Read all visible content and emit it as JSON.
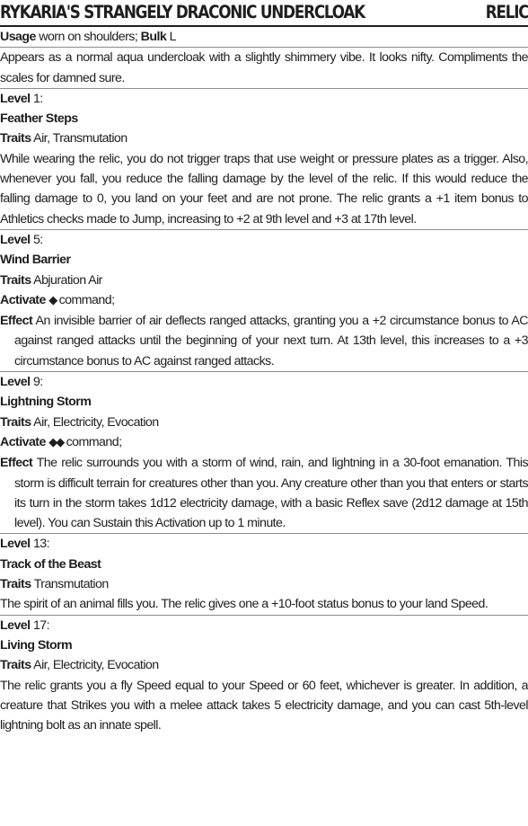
{
  "item": {
    "title": "RYKARIA'S STRANGELY DRACONIC UNDERCLOAK",
    "kind": "RELIC",
    "usage_label": "Usage",
    "usage_value": "worn on shoulders;",
    "bulk_label": "Bulk",
    "bulk_value": "L",
    "description": "Appears as a normal aqua undercloak with a slightly shimmery vibe. It looks nifty. Compliments the scales for damned sure."
  },
  "labels": {
    "level": "Level",
    "traits": "Traits",
    "activate": "Activate",
    "effect": "Effect"
  },
  "gifts": [
    {
      "level": "1:",
      "name": "Feather Steps",
      "traits": "Air, Transmutation",
      "text": "While wearing the relic, you do not trigger traps that use weight or pressure plates as a trigger. Also, whenever you fall, you reduce the falling damage by the level of the relic. If this would reduce the falling damage to 0, you land on your feet and are not prone. The relic grants a +1 item bonus to Athletics checks made to Jump, increasing to +2 at 9th level and +3 at 17th level."
    },
    {
      "level": "5:",
      "name": "Wind Barrier",
      "traits": "Abjuration Air",
      "action_glyph": "◆",
      "activate_text": "command;",
      "effect": "An invisible barrier of air deflects ranged attacks, granting you a +2 circumstance bonus to AC against ranged attacks until the beginning of your next turn. At 13th level, this increases to a +3 circumstance bonus to AC against ranged attacks."
    },
    {
      "level": "9:",
      "name": "Lightning Storm",
      "traits": "Air, Electricity, Evocation",
      "action_glyph": "◆◆",
      "activate_text": "command;",
      "effect": "The relic surrounds you with a storm of wind, rain, and lightning in a 30-foot emanation. This storm is difficult terrain for creatures other than you. Any creature other than you that enters or starts its turn in the storm takes 1d12 electricity damage, with a basic Reflex save (2d12 damage at 15th level). You can Sustain this Activation up to 1 minute."
    },
    {
      "level": "13:",
      "name": "Track of the Beast",
      "traits": "Transmutation",
      "text": "The spirit of an animal fills you. The relic gives one a +10-foot status bonus to your land Speed."
    },
    {
      "level": "17:",
      "name": "Living Storm",
      "traits": "Air, Electricity, Evocation",
      "text": "The relic grants you a fly Speed equal to your Speed or 60 feet, whichever is greater. In addition, a creature that Strikes you with a melee attack takes 5 electricity damage, and you can cast 5th-level lightning bolt as an innate spell."
    }
  ]
}
